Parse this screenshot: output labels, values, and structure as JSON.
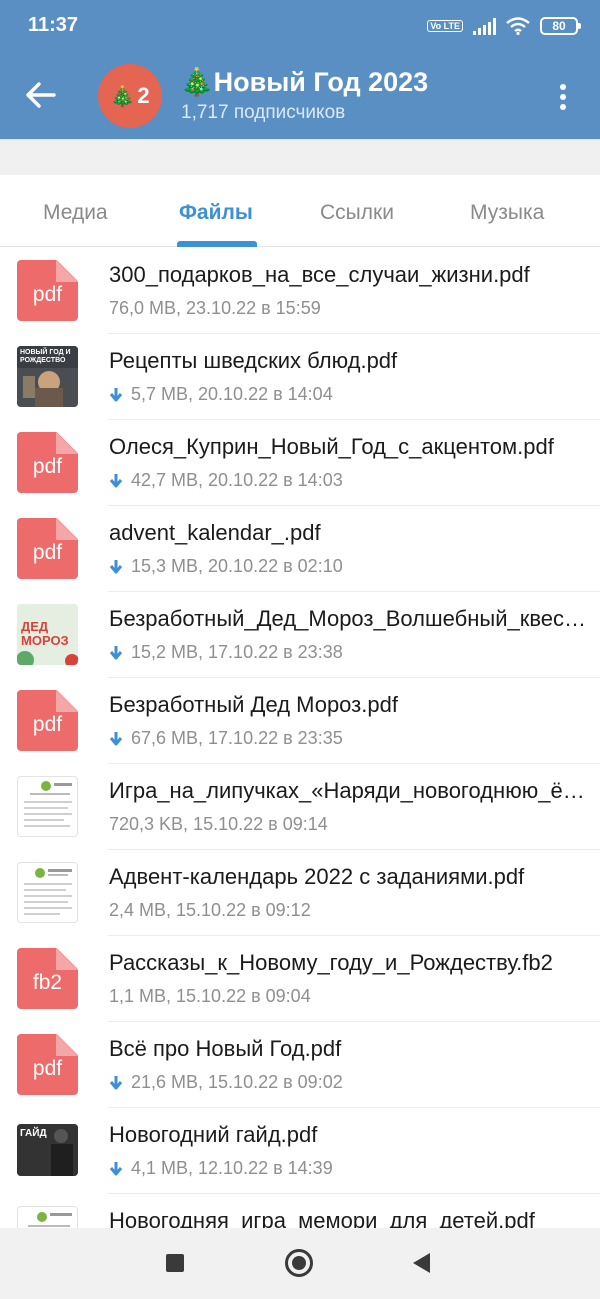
{
  "status_bar": {
    "time": "11:37",
    "volte": "Vo LTE",
    "battery": "80"
  },
  "header": {
    "back_icon": "arrow-left-icon",
    "avatar_emoji": "🎄",
    "avatar_text": "2",
    "title": "🎄Новый Год 2023",
    "subtitle": "1,717 подписчиков",
    "menu_icon": "more-vertical-icon"
  },
  "tabs": [
    {
      "label": "Медиа"
    },
    {
      "label": "Файлы",
      "active": true
    },
    {
      "label": "Ссылки"
    },
    {
      "label": "Музыка"
    }
  ],
  "colors": {
    "header": "#5a8fc4",
    "accent": "#3d8fd6",
    "file_icon": "#ee6b6b"
  },
  "files": [
    {
      "name": "300_подарков_на_все_случаи_жизни.pdf",
      "meta": "76,0 MB, 23.10.22 в 15:59",
      "icon": "pdf",
      "download": false
    },
    {
      "name": "Рецепты шведских блюд.pdf",
      "meta": "5,7 MB, 20.10.22 в 14:04",
      "icon": "thumb-photo",
      "thumb_text": "НОВЫЙ ГОД И РОЖДЕСТВО",
      "download": true
    },
    {
      "name": "Олеся_Куприн_Новый_Год_с_акцентом.pdf",
      "meta": "42,7 MB, 20.10.22 в 14:03",
      "icon": "pdf",
      "download": true
    },
    {
      "name": "advent_kalendar_.pdf",
      "meta": "15,3 MB, 20.10.22 в 02:10",
      "icon": "pdf",
      "download": true
    },
    {
      "name": "Безработный_Дед_Мороз_Волшебный_квест.pdf",
      "meta": "15,2 MB, 17.10.22 в 23:38",
      "icon": "thumb-green",
      "thumb_text": "ДЕД МОРОЗ",
      "download": true
    },
    {
      "name": "Безработный Дед Мороз.pdf",
      "meta": "67,6 MB, 17.10.22 в 23:35",
      "icon": "pdf",
      "download": true
    },
    {
      "name": "Игра_на_липучках_«Наряди_новогоднюю_ёлку».pdf",
      "meta": "720,3 KB, 15.10.22 в 09:14",
      "icon": "thumb-doc",
      "download": false
    },
    {
      "name": "Адвент-календарь 2022 с заданиями.pdf",
      "meta": "2,4 MB, 15.10.22 в 09:12",
      "icon": "thumb-doc",
      "download": false
    },
    {
      "name": "Рассказы_к_Новому_году_и_Рождеству.fb2",
      "meta": "1,1 MB, 15.10.22 в 09:04",
      "icon": "fb2",
      "download": false
    },
    {
      "name": "Всё про Новый Год.pdf",
      "meta": "21,6 MB, 15.10.22 в 09:02",
      "icon": "pdf",
      "download": true
    },
    {
      "name": "Новогодний гайд.pdf",
      "meta": "4,1 MB, 12.10.22 в 14:39",
      "icon": "thumb-dark",
      "thumb_text": "ГАЙД",
      "download": true
    },
    {
      "name": "Новогодняя_игра_мемори_для_детей.pdf",
      "meta": "",
      "icon": "thumb-doc",
      "download": false
    }
  ],
  "nav": {
    "recents_icon": "square-icon",
    "home_icon": "circle-home-icon",
    "back_icon": "triangle-back-icon"
  }
}
